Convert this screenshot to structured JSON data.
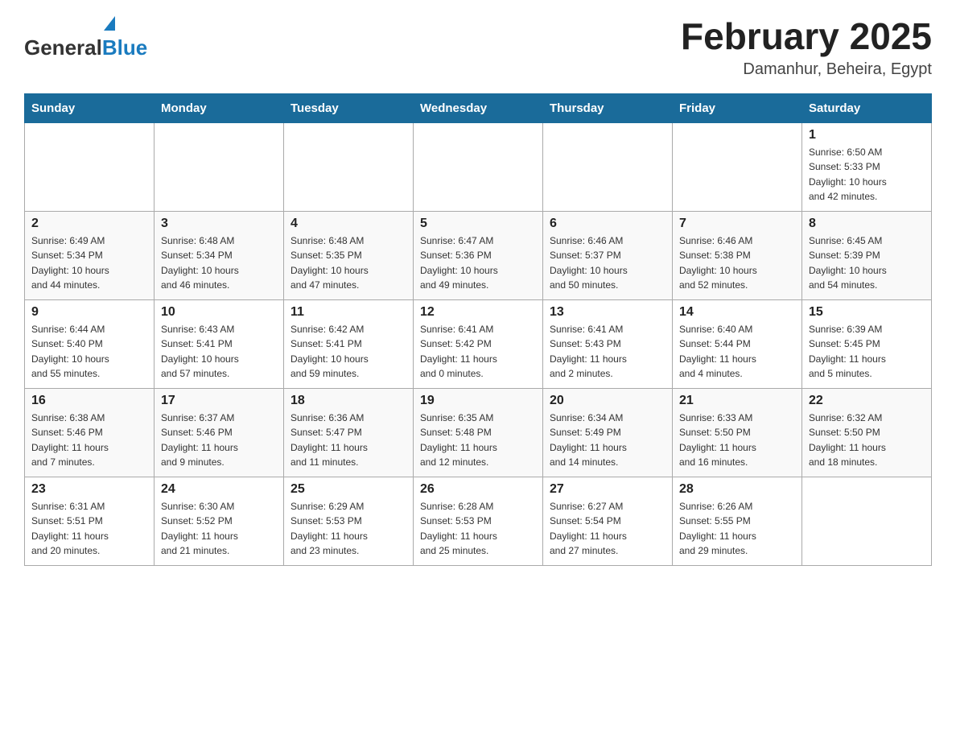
{
  "header": {
    "logo_general": "General",
    "logo_blue": "Blue",
    "month_title": "February 2025",
    "location": "Damanhur, Beheira, Egypt"
  },
  "days_of_week": [
    "Sunday",
    "Monday",
    "Tuesday",
    "Wednesday",
    "Thursday",
    "Friday",
    "Saturday"
  ],
  "weeks": [
    [
      {
        "day": "",
        "info": ""
      },
      {
        "day": "",
        "info": ""
      },
      {
        "day": "",
        "info": ""
      },
      {
        "day": "",
        "info": ""
      },
      {
        "day": "",
        "info": ""
      },
      {
        "day": "",
        "info": ""
      },
      {
        "day": "1",
        "info": "Sunrise: 6:50 AM\nSunset: 5:33 PM\nDaylight: 10 hours\nand 42 minutes."
      }
    ],
    [
      {
        "day": "2",
        "info": "Sunrise: 6:49 AM\nSunset: 5:34 PM\nDaylight: 10 hours\nand 44 minutes."
      },
      {
        "day": "3",
        "info": "Sunrise: 6:48 AM\nSunset: 5:34 PM\nDaylight: 10 hours\nand 46 minutes."
      },
      {
        "day": "4",
        "info": "Sunrise: 6:48 AM\nSunset: 5:35 PM\nDaylight: 10 hours\nand 47 minutes."
      },
      {
        "day": "5",
        "info": "Sunrise: 6:47 AM\nSunset: 5:36 PM\nDaylight: 10 hours\nand 49 minutes."
      },
      {
        "day": "6",
        "info": "Sunrise: 6:46 AM\nSunset: 5:37 PM\nDaylight: 10 hours\nand 50 minutes."
      },
      {
        "day": "7",
        "info": "Sunrise: 6:46 AM\nSunset: 5:38 PM\nDaylight: 10 hours\nand 52 minutes."
      },
      {
        "day": "8",
        "info": "Sunrise: 6:45 AM\nSunset: 5:39 PM\nDaylight: 10 hours\nand 54 minutes."
      }
    ],
    [
      {
        "day": "9",
        "info": "Sunrise: 6:44 AM\nSunset: 5:40 PM\nDaylight: 10 hours\nand 55 minutes."
      },
      {
        "day": "10",
        "info": "Sunrise: 6:43 AM\nSunset: 5:41 PM\nDaylight: 10 hours\nand 57 minutes."
      },
      {
        "day": "11",
        "info": "Sunrise: 6:42 AM\nSunset: 5:41 PM\nDaylight: 10 hours\nand 59 minutes."
      },
      {
        "day": "12",
        "info": "Sunrise: 6:41 AM\nSunset: 5:42 PM\nDaylight: 11 hours\nand 0 minutes."
      },
      {
        "day": "13",
        "info": "Sunrise: 6:41 AM\nSunset: 5:43 PM\nDaylight: 11 hours\nand 2 minutes."
      },
      {
        "day": "14",
        "info": "Sunrise: 6:40 AM\nSunset: 5:44 PM\nDaylight: 11 hours\nand 4 minutes."
      },
      {
        "day": "15",
        "info": "Sunrise: 6:39 AM\nSunset: 5:45 PM\nDaylight: 11 hours\nand 5 minutes."
      }
    ],
    [
      {
        "day": "16",
        "info": "Sunrise: 6:38 AM\nSunset: 5:46 PM\nDaylight: 11 hours\nand 7 minutes."
      },
      {
        "day": "17",
        "info": "Sunrise: 6:37 AM\nSunset: 5:46 PM\nDaylight: 11 hours\nand 9 minutes."
      },
      {
        "day": "18",
        "info": "Sunrise: 6:36 AM\nSunset: 5:47 PM\nDaylight: 11 hours\nand 11 minutes."
      },
      {
        "day": "19",
        "info": "Sunrise: 6:35 AM\nSunset: 5:48 PM\nDaylight: 11 hours\nand 12 minutes."
      },
      {
        "day": "20",
        "info": "Sunrise: 6:34 AM\nSunset: 5:49 PM\nDaylight: 11 hours\nand 14 minutes."
      },
      {
        "day": "21",
        "info": "Sunrise: 6:33 AM\nSunset: 5:50 PM\nDaylight: 11 hours\nand 16 minutes."
      },
      {
        "day": "22",
        "info": "Sunrise: 6:32 AM\nSunset: 5:50 PM\nDaylight: 11 hours\nand 18 minutes."
      }
    ],
    [
      {
        "day": "23",
        "info": "Sunrise: 6:31 AM\nSunset: 5:51 PM\nDaylight: 11 hours\nand 20 minutes."
      },
      {
        "day": "24",
        "info": "Sunrise: 6:30 AM\nSunset: 5:52 PM\nDaylight: 11 hours\nand 21 minutes."
      },
      {
        "day": "25",
        "info": "Sunrise: 6:29 AM\nSunset: 5:53 PM\nDaylight: 11 hours\nand 23 minutes."
      },
      {
        "day": "26",
        "info": "Sunrise: 6:28 AM\nSunset: 5:53 PM\nDaylight: 11 hours\nand 25 minutes."
      },
      {
        "day": "27",
        "info": "Sunrise: 6:27 AM\nSunset: 5:54 PM\nDaylight: 11 hours\nand 27 minutes."
      },
      {
        "day": "28",
        "info": "Sunrise: 6:26 AM\nSunset: 5:55 PM\nDaylight: 11 hours\nand 29 minutes."
      },
      {
        "day": "",
        "info": ""
      }
    ]
  ]
}
